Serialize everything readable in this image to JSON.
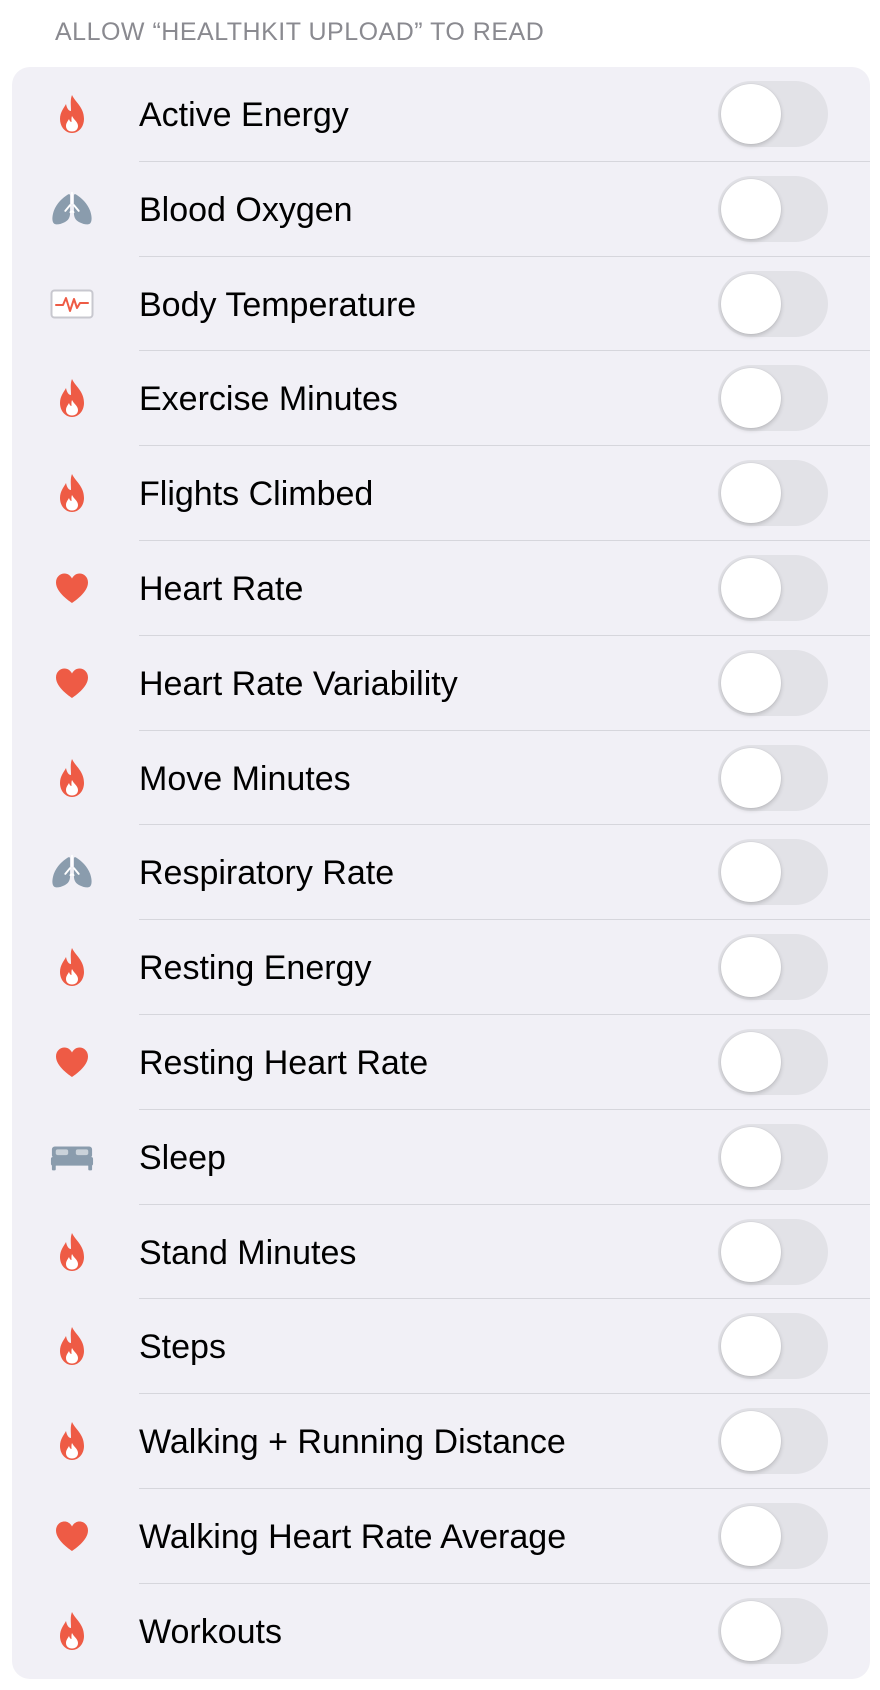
{
  "section_header": "ALLOW “HEALTHKIT UPLOAD” TO READ",
  "colors": {
    "flame": "#EE5B45",
    "heart": "#EE5B45",
    "lungs": "#8A9CAD",
    "bed": "#8A9CAD",
    "toggle_off": "#E2E2E7",
    "card_bg": "#F1F0F6"
  },
  "items": [
    {
      "label": "Active Energy",
      "icon": "flame-icon",
      "on": false
    },
    {
      "label": "Blood Oxygen",
      "icon": "lungs-icon",
      "on": false
    },
    {
      "label": "Body Temperature",
      "icon": "ecg-icon",
      "on": false
    },
    {
      "label": "Exercise Minutes",
      "icon": "flame-icon",
      "on": false
    },
    {
      "label": "Flights Climbed",
      "icon": "flame-icon",
      "on": false
    },
    {
      "label": "Heart Rate",
      "icon": "heart-icon",
      "on": false
    },
    {
      "label": "Heart Rate Variability",
      "icon": "heart-icon",
      "on": false
    },
    {
      "label": "Move Minutes",
      "icon": "flame-icon",
      "on": false
    },
    {
      "label": "Respiratory Rate",
      "icon": "lungs-icon",
      "on": false
    },
    {
      "label": "Resting Energy",
      "icon": "flame-icon",
      "on": false
    },
    {
      "label": "Resting Heart Rate",
      "icon": "heart-icon",
      "on": false
    },
    {
      "label": "Sleep",
      "icon": "bed-icon",
      "on": false
    },
    {
      "label": "Stand Minutes",
      "icon": "flame-icon",
      "on": false
    },
    {
      "label": "Steps",
      "icon": "flame-icon",
      "on": false
    },
    {
      "label": "Walking + Running Distance",
      "icon": "flame-icon",
      "on": false
    },
    {
      "label": "Walking Heart Rate Average",
      "icon": "heart-icon",
      "on": false
    },
    {
      "label": "Workouts",
      "icon": "flame-icon",
      "on": false
    }
  ]
}
